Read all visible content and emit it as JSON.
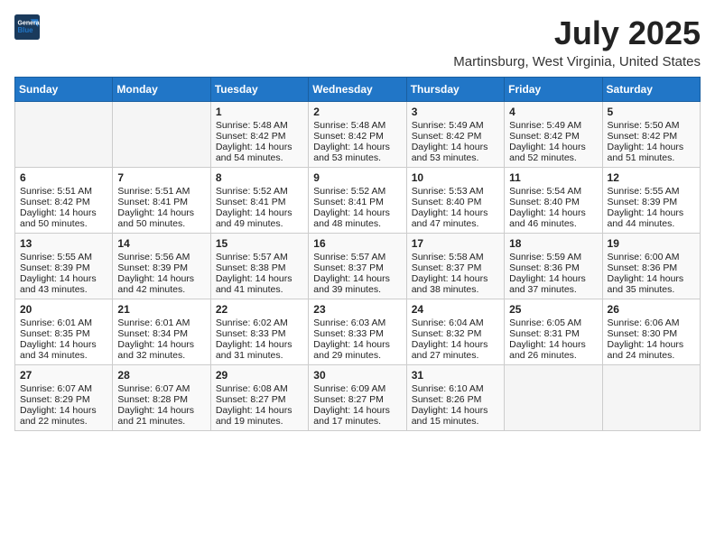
{
  "header": {
    "logo_line1": "General",
    "logo_line2": "Blue",
    "month_year": "July 2025",
    "location": "Martinsburg, West Virginia, United States"
  },
  "days_of_week": [
    "Sunday",
    "Monday",
    "Tuesday",
    "Wednesday",
    "Thursday",
    "Friday",
    "Saturday"
  ],
  "weeks": [
    [
      {
        "day": "",
        "info": ""
      },
      {
        "day": "",
        "info": ""
      },
      {
        "day": "1",
        "info": "Sunrise: 5:48 AM\nSunset: 8:42 PM\nDaylight: 14 hours\nand 54 minutes."
      },
      {
        "day": "2",
        "info": "Sunrise: 5:48 AM\nSunset: 8:42 PM\nDaylight: 14 hours\nand 53 minutes."
      },
      {
        "day": "3",
        "info": "Sunrise: 5:49 AM\nSunset: 8:42 PM\nDaylight: 14 hours\nand 53 minutes."
      },
      {
        "day": "4",
        "info": "Sunrise: 5:49 AM\nSunset: 8:42 PM\nDaylight: 14 hours\nand 52 minutes."
      },
      {
        "day": "5",
        "info": "Sunrise: 5:50 AM\nSunset: 8:42 PM\nDaylight: 14 hours\nand 51 minutes."
      }
    ],
    [
      {
        "day": "6",
        "info": "Sunrise: 5:51 AM\nSunset: 8:42 PM\nDaylight: 14 hours\nand 50 minutes."
      },
      {
        "day": "7",
        "info": "Sunrise: 5:51 AM\nSunset: 8:41 PM\nDaylight: 14 hours\nand 50 minutes."
      },
      {
        "day": "8",
        "info": "Sunrise: 5:52 AM\nSunset: 8:41 PM\nDaylight: 14 hours\nand 49 minutes."
      },
      {
        "day": "9",
        "info": "Sunrise: 5:52 AM\nSunset: 8:41 PM\nDaylight: 14 hours\nand 48 minutes."
      },
      {
        "day": "10",
        "info": "Sunrise: 5:53 AM\nSunset: 8:40 PM\nDaylight: 14 hours\nand 47 minutes."
      },
      {
        "day": "11",
        "info": "Sunrise: 5:54 AM\nSunset: 8:40 PM\nDaylight: 14 hours\nand 46 minutes."
      },
      {
        "day": "12",
        "info": "Sunrise: 5:55 AM\nSunset: 8:39 PM\nDaylight: 14 hours\nand 44 minutes."
      }
    ],
    [
      {
        "day": "13",
        "info": "Sunrise: 5:55 AM\nSunset: 8:39 PM\nDaylight: 14 hours\nand 43 minutes."
      },
      {
        "day": "14",
        "info": "Sunrise: 5:56 AM\nSunset: 8:39 PM\nDaylight: 14 hours\nand 42 minutes."
      },
      {
        "day": "15",
        "info": "Sunrise: 5:57 AM\nSunset: 8:38 PM\nDaylight: 14 hours\nand 41 minutes."
      },
      {
        "day": "16",
        "info": "Sunrise: 5:57 AM\nSunset: 8:37 PM\nDaylight: 14 hours\nand 39 minutes."
      },
      {
        "day": "17",
        "info": "Sunrise: 5:58 AM\nSunset: 8:37 PM\nDaylight: 14 hours\nand 38 minutes."
      },
      {
        "day": "18",
        "info": "Sunrise: 5:59 AM\nSunset: 8:36 PM\nDaylight: 14 hours\nand 37 minutes."
      },
      {
        "day": "19",
        "info": "Sunrise: 6:00 AM\nSunset: 8:36 PM\nDaylight: 14 hours\nand 35 minutes."
      }
    ],
    [
      {
        "day": "20",
        "info": "Sunrise: 6:01 AM\nSunset: 8:35 PM\nDaylight: 14 hours\nand 34 minutes."
      },
      {
        "day": "21",
        "info": "Sunrise: 6:01 AM\nSunset: 8:34 PM\nDaylight: 14 hours\nand 32 minutes."
      },
      {
        "day": "22",
        "info": "Sunrise: 6:02 AM\nSunset: 8:33 PM\nDaylight: 14 hours\nand 31 minutes."
      },
      {
        "day": "23",
        "info": "Sunrise: 6:03 AM\nSunset: 8:33 PM\nDaylight: 14 hours\nand 29 minutes."
      },
      {
        "day": "24",
        "info": "Sunrise: 6:04 AM\nSunset: 8:32 PM\nDaylight: 14 hours\nand 27 minutes."
      },
      {
        "day": "25",
        "info": "Sunrise: 6:05 AM\nSunset: 8:31 PM\nDaylight: 14 hours\nand 26 minutes."
      },
      {
        "day": "26",
        "info": "Sunrise: 6:06 AM\nSunset: 8:30 PM\nDaylight: 14 hours\nand 24 minutes."
      }
    ],
    [
      {
        "day": "27",
        "info": "Sunrise: 6:07 AM\nSunset: 8:29 PM\nDaylight: 14 hours\nand 22 minutes."
      },
      {
        "day": "28",
        "info": "Sunrise: 6:07 AM\nSunset: 8:28 PM\nDaylight: 14 hours\nand 21 minutes."
      },
      {
        "day": "29",
        "info": "Sunrise: 6:08 AM\nSunset: 8:27 PM\nDaylight: 14 hours\nand 19 minutes."
      },
      {
        "day": "30",
        "info": "Sunrise: 6:09 AM\nSunset: 8:27 PM\nDaylight: 14 hours\nand 17 minutes."
      },
      {
        "day": "31",
        "info": "Sunrise: 6:10 AM\nSunset: 8:26 PM\nDaylight: 14 hours\nand 15 minutes."
      },
      {
        "day": "",
        "info": ""
      },
      {
        "day": "",
        "info": ""
      }
    ]
  ]
}
